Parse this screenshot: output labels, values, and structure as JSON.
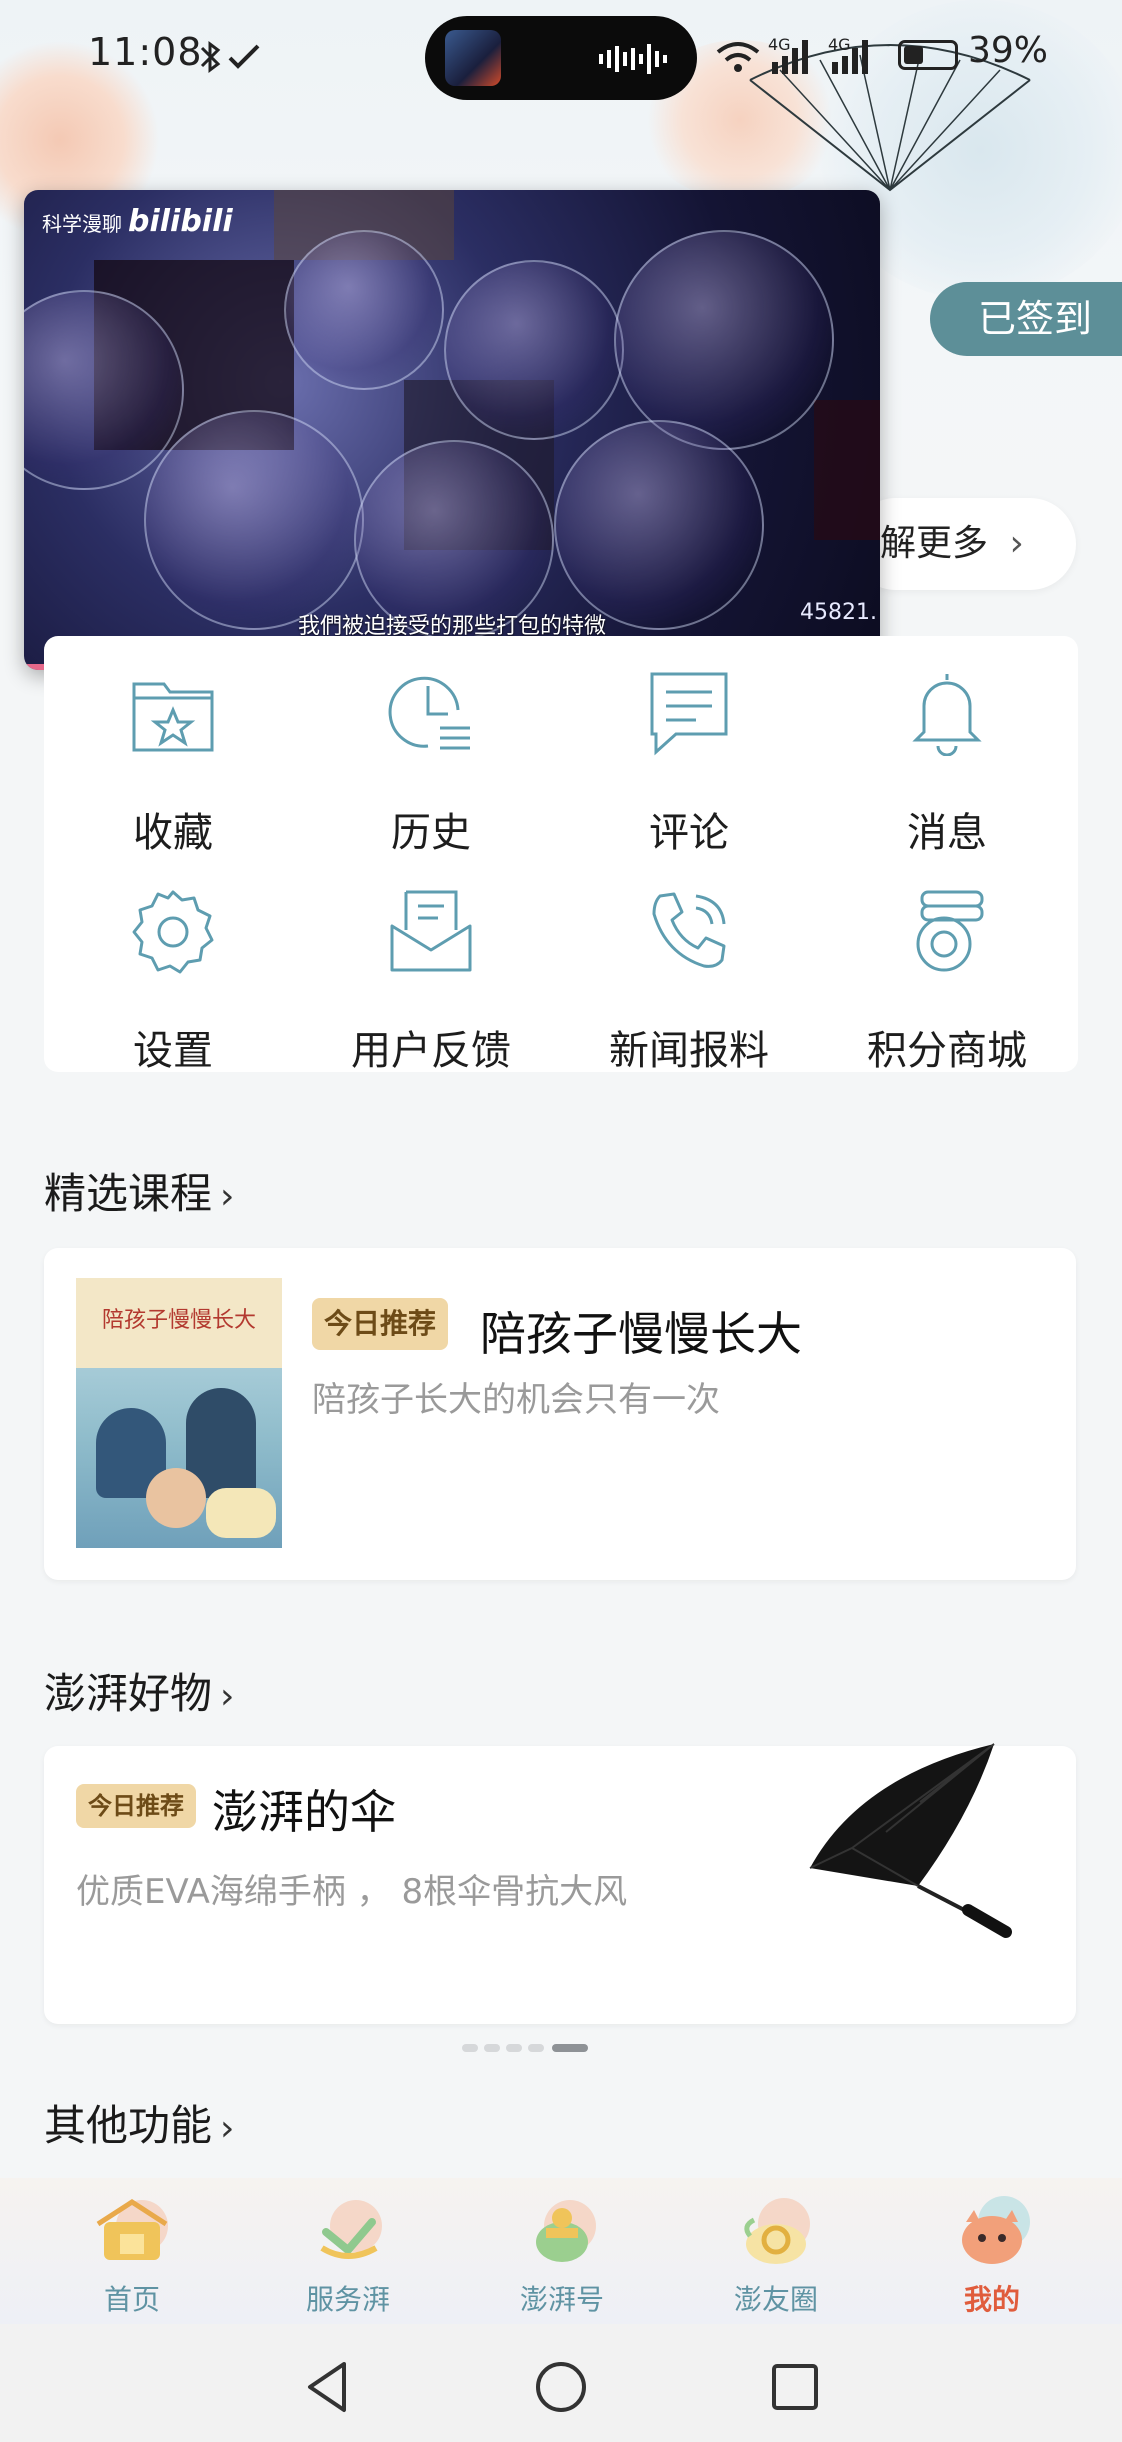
{
  "status_bar": {
    "time": "11:08",
    "network": "4G",
    "battery_percent": "39%",
    "battery_level": 0.39
  },
  "pip_video": {
    "logo_text": "科学漫聊",
    "logo_brand": "bilibili",
    "subtitle": "我們被迫接受的那些打包的特微",
    "overlay_number": "45821.",
    "progress": 0.36
  },
  "header": {
    "signin_label": "已签到",
    "learn_more_label": "解更多"
  },
  "grid": {
    "items": [
      {
        "label": "收藏",
        "icon": "folder-star-icon"
      },
      {
        "label": "历史",
        "icon": "clock-list-icon"
      },
      {
        "label": "评论",
        "icon": "comment-icon"
      },
      {
        "label": "消息",
        "icon": "bell-icon"
      },
      {
        "label": "设置",
        "icon": "gear-icon"
      },
      {
        "label": "用户反馈",
        "icon": "feedback-envelope-icon"
      },
      {
        "label": "新闻报料",
        "icon": "phone-icon"
      },
      {
        "label": "积分商城",
        "icon": "coin-stack-icon"
      }
    ]
  },
  "courses": {
    "section_title": "精选课程",
    "tag": "今日推荐",
    "title": "陪孩子慢慢长大",
    "subtitle": "陪孩子长大的机会只有一次",
    "book_title": "陪孩子慢慢长大"
  },
  "goods": {
    "section_title": "澎湃好物",
    "tag": "今日推荐",
    "title": "澎湃的伞",
    "subtitle": "优质EVA海绵手柄 ， 8根伞骨抗大风"
  },
  "other": {
    "section_title": "其他功能"
  },
  "carousel": {
    "count": 5,
    "active_index": 4
  },
  "tabbar": {
    "tabs": [
      {
        "label": "首页",
        "active": false
      },
      {
        "label": "服务湃",
        "active": false
      },
      {
        "label": "澎湃号",
        "active": false
      },
      {
        "label": "澎友圈",
        "active": false
      },
      {
        "label": "我的",
        "active": true
      }
    ]
  },
  "colors": {
    "accent_teal": "#5d8f98",
    "icon_stroke": "#5e9db0",
    "active_tab": "#e05c3c",
    "tag_bg": "#f0d7a6"
  }
}
